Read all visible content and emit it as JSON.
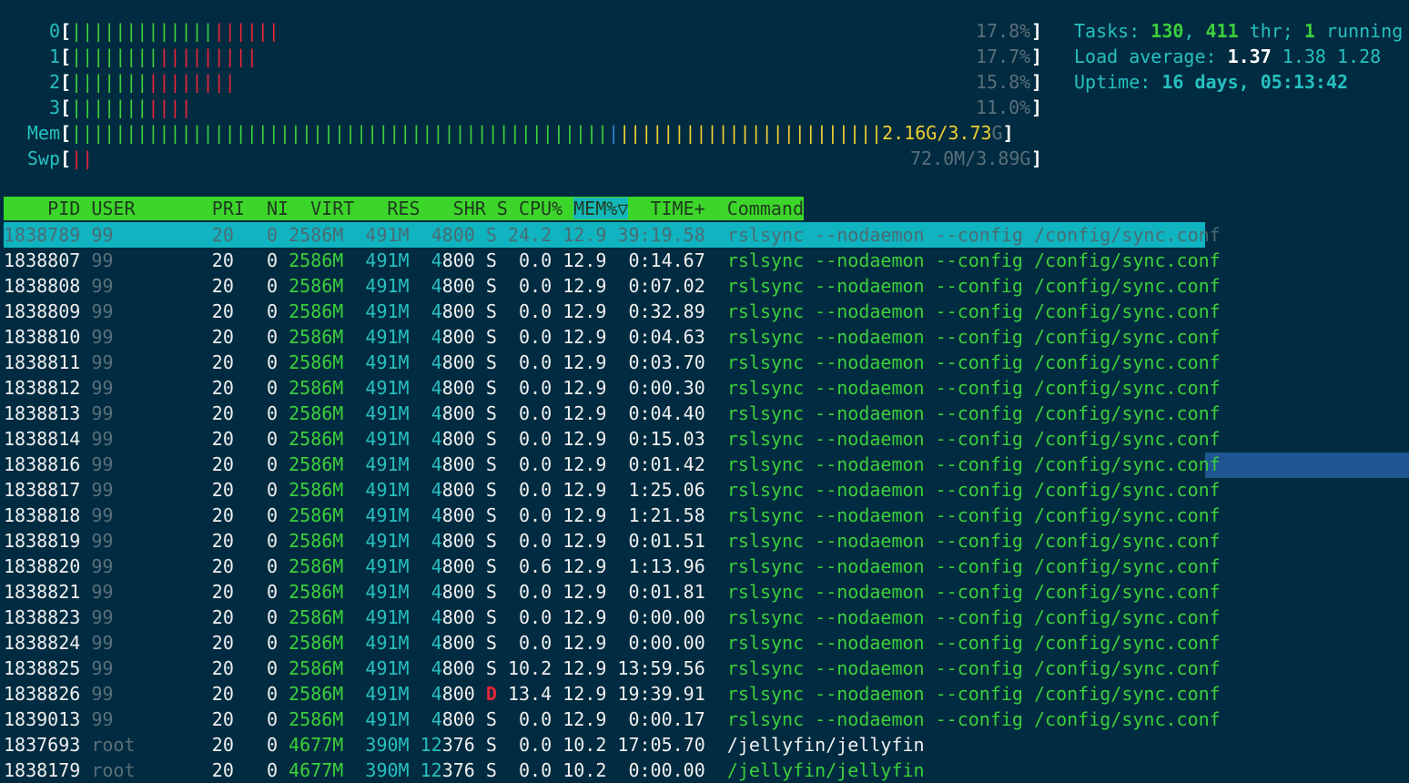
{
  "cpu_meters": [
    {
      "label": "0",
      "green": 13,
      "red": 6,
      "value": "17.8%"
    },
    {
      "label": "1",
      "green": 8,
      "red": 9,
      "value": "17.7%"
    },
    {
      "label": "2",
      "green": 7,
      "red": 8,
      "value": "15.8%"
    },
    {
      "label": "3",
      "green": 7,
      "red": 4,
      "value": "11.0%"
    }
  ],
  "mem": {
    "label": "Mem",
    "value_used": "2.16G",
    "value_sep": "/",
    "value_total": "3.73",
    "value_unit": "G",
    "green": 49,
    "blue": 1,
    "yellow": 24
  },
  "swp": {
    "label": "Swp",
    "value": "72.0M/3.89G",
    "red": 2
  },
  "info": {
    "tasks_label": "Tasks: ",
    "tasks": "130",
    "sep1": ", ",
    "thr": "411",
    "thr_label": " thr; ",
    "running": "1",
    "running_label": " running",
    "load_label": "Load average: ",
    "load1": "1.37",
    "load5": "1.38",
    "load15": "1.28",
    "uptime_label": "Uptime: ",
    "uptime": "16 days, 05:13:42"
  },
  "header": {
    "pre": "    PID USER       PRI  NI  VIRT   RES   SHR S CPU% ",
    "sort": "MEM%▽",
    "post": "  TIME+  Command"
  },
  "processes": [
    {
      "pid": "1838789",
      "user": "99",
      "pri": "20",
      "ni": "0",
      "virt": "2586M",
      "res": "491M",
      "shr": "4800",
      "s": "S",
      "cpu": "24.2",
      "mem": "12.9",
      "time": "39:19.58",
      "cmd": "rslsync --nodaemon --config /config/sync.conf",
      "selected": true
    },
    {
      "pid": "1838807",
      "user": "99",
      "pri": "20",
      "ni": "0",
      "virt": "2586M",
      "res": "491M",
      "shr": "4800",
      "s": "S",
      "cpu": "0.0",
      "mem": "12.9",
      "time": "0:14.67",
      "cmd": "rslsync --nodaemon --config /config/sync.conf"
    },
    {
      "pid": "1838808",
      "user": "99",
      "pri": "20",
      "ni": "0",
      "virt": "2586M",
      "res": "491M",
      "shr": "4800",
      "s": "S",
      "cpu": "0.0",
      "mem": "12.9",
      "time": "0:07.02",
      "cmd": "rslsync --nodaemon --config /config/sync.conf"
    },
    {
      "pid": "1838809",
      "user": "99",
      "pri": "20",
      "ni": "0",
      "virt": "2586M",
      "res": "491M",
      "shr": "4800",
      "s": "S",
      "cpu": "0.0",
      "mem": "12.9",
      "time": "0:32.89",
      "cmd": "rslsync --nodaemon --config /config/sync.conf"
    },
    {
      "pid": "1838810",
      "user": "99",
      "pri": "20",
      "ni": "0",
      "virt": "2586M",
      "res": "491M",
      "shr": "4800",
      "s": "S",
      "cpu": "0.0",
      "mem": "12.9",
      "time": "0:04.63",
      "cmd": "rslsync --nodaemon --config /config/sync.conf"
    },
    {
      "pid": "1838811",
      "user": "99",
      "pri": "20",
      "ni": "0",
      "virt": "2586M",
      "res": "491M",
      "shr": "4800",
      "s": "S",
      "cpu": "0.0",
      "mem": "12.9",
      "time": "0:03.70",
      "cmd": "rslsync --nodaemon --config /config/sync.conf"
    },
    {
      "pid": "1838812",
      "user": "99",
      "pri": "20",
      "ni": "0",
      "virt": "2586M",
      "res": "491M",
      "shr": "4800",
      "s": "S",
      "cpu": "0.0",
      "mem": "12.9",
      "time": "0:00.30",
      "cmd": "rslsync --nodaemon --config /config/sync.conf"
    },
    {
      "pid": "1838813",
      "user": "99",
      "pri": "20",
      "ni": "0",
      "virt": "2586M",
      "res": "491M",
      "shr": "4800",
      "s": "S",
      "cpu": "0.0",
      "mem": "12.9",
      "time": "0:04.40",
      "cmd": "rslsync --nodaemon --config /config/sync.conf"
    },
    {
      "pid": "1838814",
      "user": "99",
      "pri": "20",
      "ni": "0",
      "virt": "2586M",
      "res": "491M",
      "shr": "4800",
      "s": "S",
      "cpu": "0.0",
      "mem": "12.9",
      "time": "0:15.03",
      "cmd": "rslsync --nodaemon --config /config/sync.conf"
    },
    {
      "pid": "1838816",
      "user": "99",
      "pri": "20",
      "ni": "0",
      "virt": "2586M",
      "res": "491M",
      "shr": "4800",
      "s": "S",
      "cpu": "0.0",
      "mem": "12.9",
      "time": "0:01.42",
      "cmd": "rslsync --nodaemon --config /config/sync.conf"
    },
    {
      "pid": "1838817",
      "user": "99",
      "pri": "20",
      "ni": "0",
      "virt": "2586M",
      "res": "491M",
      "shr": "4800",
      "s": "S",
      "cpu": "0.0",
      "mem": "12.9",
      "time": "1:25.06",
      "cmd": "rslsync --nodaemon --config /config/sync.conf"
    },
    {
      "pid": "1838818",
      "user": "99",
      "pri": "20",
      "ni": "0",
      "virt": "2586M",
      "res": "491M",
      "shr": "4800",
      "s": "S",
      "cpu": "0.0",
      "mem": "12.9",
      "time": "1:21.58",
      "cmd": "rslsync --nodaemon --config /config/sync.conf"
    },
    {
      "pid": "1838819",
      "user": "99",
      "pri": "20",
      "ni": "0",
      "virt": "2586M",
      "res": "491M",
      "shr": "4800",
      "s": "S",
      "cpu": "0.0",
      "mem": "12.9",
      "time": "0:01.51",
      "cmd": "rslsync --nodaemon --config /config/sync.conf"
    },
    {
      "pid": "1838820",
      "user": "99",
      "pri": "20",
      "ni": "0",
      "virt": "2586M",
      "res": "491M",
      "shr": "4800",
      "s": "S",
      "cpu": "0.6",
      "mem": "12.9",
      "time": "1:13.96",
      "cmd": "rslsync --nodaemon --config /config/sync.conf"
    },
    {
      "pid": "1838821",
      "user": "99",
      "pri": "20",
      "ni": "0",
      "virt": "2586M",
      "res": "491M",
      "shr": "4800",
      "s": "S",
      "cpu": "0.0",
      "mem": "12.9",
      "time": "0:01.81",
      "cmd": "rslsync --nodaemon --config /config/sync.conf"
    },
    {
      "pid": "1838823",
      "user": "99",
      "pri": "20",
      "ni": "0",
      "virt": "2586M",
      "res": "491M",
      "shr": "4800",
      "s": "S",
      "cpu": "0.0",
      "mem": "12.9",
      "time": "0:00.00",
      "cmd": "rslsync --nodaemon --config /config/sync.conf"
    },
    {
      "pid": "1838824",
      "user": "99",
      "pri": "20",
      "ni": "0",
      "virt": "2586M",
      "res": "491M",
      "shr": "4800",
      "s": "S",
      "cpu": "0.0",
      "mem": "12.9",
      "time": "0:00.00",
      "cmd": "rslsync --nodaemon --config /config/sync.conf"
    },
    {
      "pid": "1838825",
      "user": "99",
      "pri": "20",
      "ni": "0",
      "virt": "2586M",
      "res": "491M",
      "shr": "4800",
      "s": "S",
      "cpu": "10.2",
      "mem": "12.9",
      "time": "13:59.56",
      "cmd": "rslsync --nodaemon --config /config/sync.conf"
    },
    {
      "pid": "1838826",
      "user": "99",
      "pri": "20",
      "ni": "0",
      "virt": "2586M",
      "res": "491M",
      "shr": "4800",
      "s": "D",
      "cpu": "13.4",
      "mem": "12.9",
      "time": "19:39.91",
      "cmd": "rslsync --nodaemon --config /config/sync.conf"
    },
    {
      "pid": "1839013",
      "user": "99",
      "pri": "20",
      "ni": "0",
      "virt": "2586M",
      "res": "491M",
      "shr": "4800",
      "s": "S",
      "cpu": "0.0",
      "mem": "12.9",
      "time": "0:00.17",
      "cmd": "rslsync --nodaemon --config /config/sync.conf"
    },
    {
      "pid": "1837693",
      "user": "root",
      "pri": "20",
      "ni": "0",
      "virt": "4677M",
      "res": "390M",
      "shr": "12376",
      "s": "S",
      "cpu": "0.0",
      "mem": "10.2",
      "time": "17:05.70",
      "cmd": "/jellyfin/jellyfin",
      "cmd_white": true
    },
    {
      "pid": "1838179",
      "user": "root",
      "pri": "20",
      "ni": "0",
      "virt": "4677M",
      "res": "390M",
      "shr": "12376",
      "s": "S",
      "cpu": "0.0",
      "mem": "10.2",
      "time": "0:00.00",
      "cmd": "/jellyfin/jellyfin"
    }
  ]
}
